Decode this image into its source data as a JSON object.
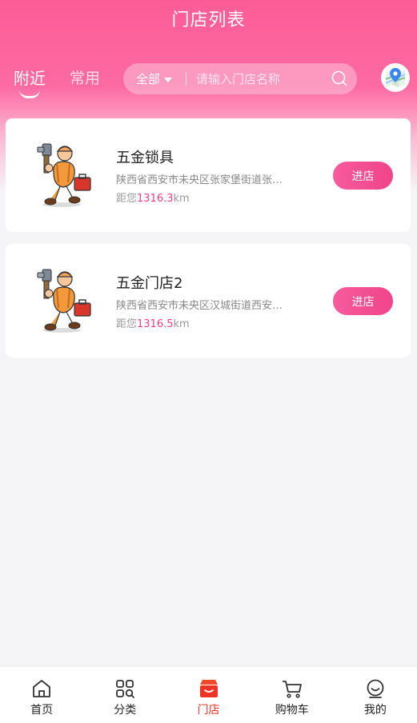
{
  "header": {
    "title": "门店列表"
  },
  "tabs": [
    {
      "label": "附近",
      "active": true
    },
    {
      "label": "常用",
      "active": false
    }
  ],
  "search": {
    "filter_label": "全部",
    "placeholder": "请输入门店名称"
  },
  "stores": [
    {
      "name": "五金锁具",
      "address": "陕西省西安市未央区张家堡街道张…",
      "distance_prefix": "距您",
      "distance_value": "1316.3",
      "distance_unit": "km",
      "enter_label": "进店"
    },
    {
      "name": "五金门店2",
      "address": "陕西省西安市未央区汉城街道西安…",
      "distance_prefix": "距您",
      "distance_value": "1316.5",
      "distance_unit": "km",
      "enter_label": "进店"
    }
  ],
  "tabbar": {
    "items": [
      {
        "label": "首页",
        "icon": "home-icon",
        "active": false
      },
      {
        "label": "分类",
        "icon": "category-icon",
        "active": false
      },
      {
        "label": "门店",
        "icon": "store-icon",
        "active": true
      },
      {
        "label": "购物车",
        "icon": "cart-icon",
        "active": false
      },
      {
        "label": "我的",
        "icon": "profile-icon",
        "active": false
      }
    ]
  },
  "colors": {
    "brand_pink": "#fc5c96",
    "accent_red": "#ee3424",
    "distance_pink": "#ee3f83"
  }
}
